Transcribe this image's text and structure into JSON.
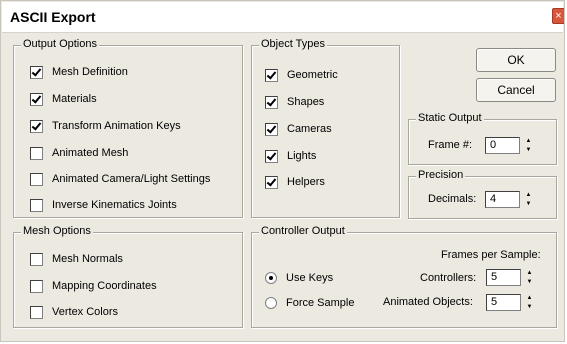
{
  "window": {
    "title": "ASCII Export",
    "close_glyph": "×"
  },
  "output_options": {
    "legend": "Output Options",
    "items": [
      {
        "label": "Mesh Definition",
        "checked": true
      },
      {
        "label": "Materials",
        "checked": true
      },
      {
        "label": "Transform Animation Keys",
        "checked": true
      },
      {
        "label": "Animated Mesh",
        "checked": false
      },
      {
        "label": "Animated Camera/Light Settings",
        "checked": false
      },
      {
        "label": "Inverse Kinematics Joints",
        "checked": false
      }
    ]
  },
  "object_types": {
    "legend": "Object Types",
    "items": [
      {
        "label": "Geometric",
        "checked": true
      },
      {
        "label": "Shapes",
        "checked": true
      },
      {
        "label": "Cameras",
        "checked": true
      },
      {
        "label": "Lights",
        "checked": true
      },
      {
        "label": "Helpers",
        "checked": true
      }
    ]
  },
  "buttons": {
    "ok": "OK",
    "cancel": "Cancel"
  },
  "static_output": {
    "legend": "Static Output",
    "frame_label": "Frame #:",
    "frame_value": "0"
  },
  "precision": {
    "legend": "Precision",
    "decimals_label": "Decimals:",
    "decimals_value": "4"
  },
  "mesh_options": {
    "legend": "Mesh Options",
    "items": [
      {
        "label": "Mesh Normals",
        "checked": false
      },
      {
        "label": "Mapping Coordinates",
        "checked": false
      },
      {
        "label": "Vertex Colors",
        "checked": false
      }
    ]
  },
  "controller_output": {
    "legend": "Controller Output",
    "frames_per_sample_label": "Frames per Sample:",
    "use_keys_label": "Use Keys",
    "force_sample_label": "Force Sample",
    "selected": "use_keys",
    "controllers_label": "Controllers:",
    "controllers_value": "5",
    "animated_objects_label": "Animated Objects:",
    "animated_objects_value": "5"
  },
  "icons": {
    "checkbox_checked": "checkbox-checked-icon",
    "spinner_up": "▲",
    "spinner_down": "▼"
  }
}
